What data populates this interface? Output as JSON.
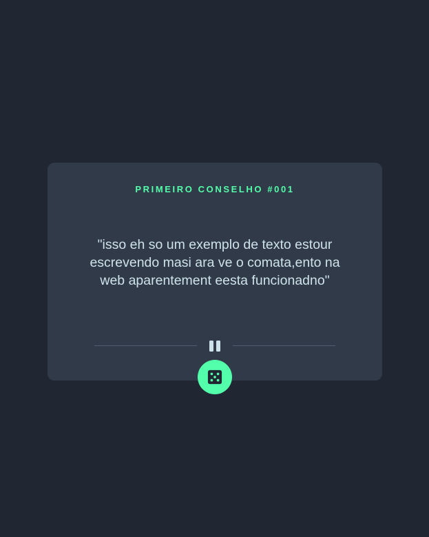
{
  "card": {
    "title": "PRIMEIRO CONSELHO #001",
    "quote": "\"isso eh so um exemplo de texto estour escrevendo masi ara ve o comata,ento na web aparentement eesta funcionadno\""
  },
  "icons": {
    "divider_icon": "pause-icon",
    "button_icon": "dice-icon"
  },
  "colors": {
    "background": "#202632",
    "card": "#313a48",
    "accent": "#53ffaa",
    "text": "#cee3e9",
    "divider": "#4f5d74"
  }
}
